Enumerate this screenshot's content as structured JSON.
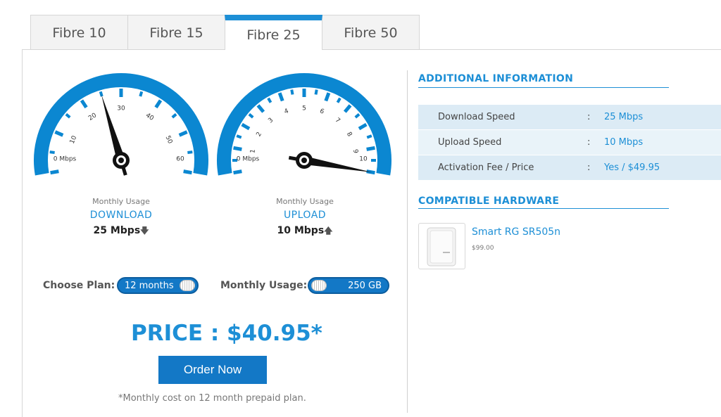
{
  "tabs": [
    {
      "label": "Fibre 10"
    },
    {
      "label": "Fibre 15"
    },
    {
      "label": "Fibre 25",
      "active": true
    },
    {
      "label": "Fibre 50"
    }
  ],
  "download_gauge": {
    "tick_labels": [
      "0 Mbps",
      "10",
      "20",
      "30",
      "40",
      "50",
      "60"
    ],
    "value": 25,
    "max": 60,
    "caption_small": "Monthly Usage",
    "caption_title": "DOWNLOAD",
    "caption_value": "25 Mbps",
    "arrow_icon": "arrow-down-icon"
  },
  "upload_gauge": {
    "tick_labels": [
      "0 Mbps",
      "1",
      "2",
      "3",
      "4",
      "5",
      "6",
      "7",
      "8",
      "9",
      "10"
    ],
    "value": 10,
    "max": 10,
    "caption_small": "Monthly Usage",
    "caption_title": "UPLOAD",
    "caption_value": "10 Mbps",
    "arrow_icon": "arrow-up-icon"
  },
  "controls": {
    "choose_plan_label": "Choose Plan:",
    "plan_value": "12 months",
    "monthly_usage_label": "Monthly Usage:",
    "usage_value": "250 GB"
  },
  "price": "PRICE : $40.95*",
  "order_button": "Order Now",
  "note": "*Monthly cost on 12 month prepaid plan.",
  "additional_info": {
    "title": "ADDITIONAL INFORMATION",
    "rows": [
      {
        "key": "Download Speed",
        "sep": ":",
        "value": "25 Mbps"
      },
      {
        "key": "Upload Speed",
        "sep": ":",
        "value": "10 Mbps"
      },
      {
        "key": "Activation Fee / Price",
        "sep": ":",
        "value": "Yes / $49.95"
      }
    ]
  },
  "hardware": {
    "title": "COMPATIBLE HARDWARE",
    "items": [
      {
        "name": "Smart RG SR505n",
        "price": "$99.00"
      }
    ]
  },
  "colors": {
    "accent": "#1d8fd6",
    "button": "#1378c6",
    "gauge_arc": "#0b87d1"
  }
}
